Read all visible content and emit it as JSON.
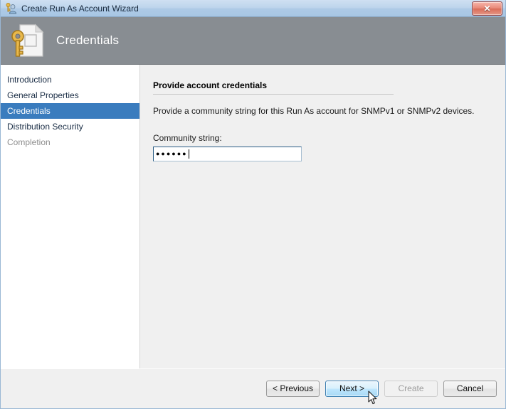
{
  "window": {
    "title": "Create Run As Account Wizard",
    "title_icon": "runas-account-icon",
    "close_label": "✕"
  },
  "banner": {
    "title": "Credentials",
    "icon": "key-document-icon"
  },
  "sidebar": {
    "items": [
      {
        "label": "Introduction",
        "state": "normal"
      },
      {
        "label": "General Properties",
        "state": "normal"
      },
      {
        "label": "Credentials",
        "state": "selected"
      },
      {
        "label": "Distribution Security",
        "state": "normal"
      },
      {
        "label": "Completion",
        "state": "disabled"
      }
    ]
  },
  "content": {
    "section_title": "Provide account credentials",
    "description": "Provide a community string for this Run As account for SNMPv1 or SNMPv2 devices.",
    "field_label": "Community string:",
    "field_value": "●●●●●●",
    "field_placeholder": "",
    "field_char_count": 6
  },
  "footer": {
    "buttons": [
      {
        "label": "< Previous",
        "state": "normal"
      },
      {
        "label": "Next >",
        "state": "hover"
      },
      {
        "label": "Create",
        "state": "disabled"
      },
      {
        "label": "Cancel",
        "state": "normal"
      }
    ]
  },
  "colors": {
    "titlebar_top": "#cfe0f2",
    "titlebar_bottom": "#a7c6e4",
    "banner_bg": "#888d92",
    "selection_blue": "#3a7cbe",
    "accent_button_blue": "#bee6fd",
    "close_red": "#d96b58",
    "key_gold": "#e0a82e"
  }
}
